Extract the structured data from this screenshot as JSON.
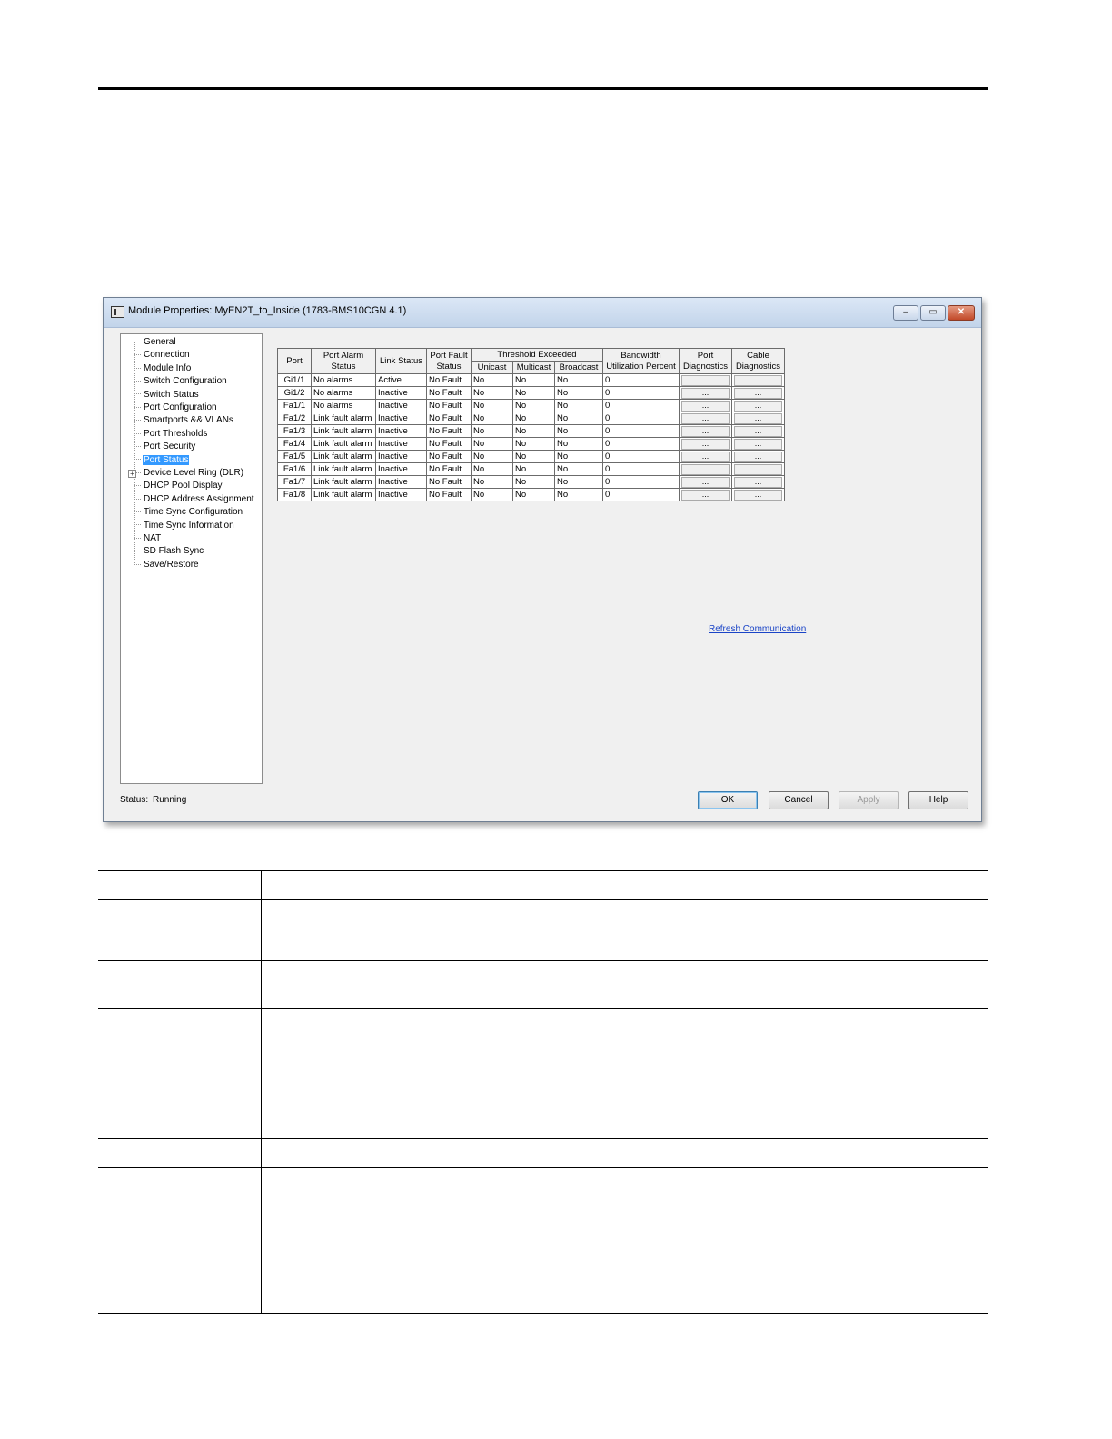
{
  "dialog": {
    "title": "Module Properties: MyEN2T_to_Inside (1783-BMS10CGN 4.1)",
    "window_buttons": {
      "minimize": "–",
      "restore": "▭",
      "close": "✕"
    }
  },
  "tree": {
    "items": [
      {
        "label": "General"
      },
      {
        "label": "Connection"
      },
      {
        "label": "Module Info"
      },
      {
        "label": "Switch Configuration"
      },
      {
        "label": "Switch Status"
      },
      {
        "label": "Port Configuration"
      },
      {
        "label": "Smartports && VLANs"
      },
      {
        "label": "Port Thresholds"
      },
      {
        "label": "Port Security"
      },
      {
        "label": "Port Status",
        "selected": true
      },
      {
        "label": "Device Level Ring (DLR)",
        "expandable": true
      },
      {
        "label": "DHCP Pool Display"
      },
      {
        "label": "DHCP Address Assignment"
      },
      {
        "label": "Time Sync Configuration"
      },
      {
        "label": "Time Sync Information"
      },
      {
        "label": "NAT"
      },
      {
        "label": "SD Flash Sync"
      },
      {
        "label": "Save/Restore"
      }
    ]
  },
  "grid": {
    "headers": {
      "port": "Port",
      "alarm": "Port Alarm Status",
      "link": "Link Status",
      "fault": "Port Fault Status",
      "threshold": "Threshold Exceeded",
      "unicast": "Unicast",
      "multicast": "Multicast",
      "broadcast": "Broadcast",
      "bandwidth": "Bandwidth Utilization Percent",
      "port_diag": "Port Diagnostics",
      "cable_diag": "Cable Diagnostics"
    },
    "rows": [
      {
        "port": "Gi1/1",
        "alarm": "No alarms",
        "link": "Active",
        "fault": "No Fault",
        "unicast": "No",
        "multicast": "No",
        "broadcast": "No",
        "bandwidth": "0",
        "port_diag": "...",
        "cable_diag": "..."
      },
      {
        "port": "Gi1/2",
        "alarm": "No alarms",
        "link": "Inactive",
        "fault": "No Fault",
        "unicast": "No",
        "multicast": "No",
        "broadcast": "No",
        "bandwidth": "0",
        "port_diag": "...",
        "cable_diag": "..."
      },
      {
        "port": "Fa1/1",
        "alarm": "No alarms",
        "link": "Inactive",
        "fault": "No Fault",
        "unicast": "No",
        "multicast": "No",
        "broadcast": "No",
        "bandwidth": "0",
        "port_diag": "...",
        "cable_diag": "..."
      },
      {
        "port": "Fa1/2",
        "alarm": "Link fault alarm",
        "link": "Inactive",
        "fault": "No Fault",
        "unicast": "No",
        "multicast": "No",
        "broadcast": "No",
        "bandwidth": "0",
        "port_diag": "...",
        "cable_diag": "..."
      },
      {
        "port": "Fa1/3",
        "alarm": "Link fault alarm",
        "link": "Inactive",
        "fault": "No Fault",
        "unicast": "No",
        "multicast": "No",
        "broadcast": "No",
        "bandwidth": "0",
        "port_diag": "...",
        "cable_diag": "..."
      },
      {
        "port": "Fa1/4",
        "alarm": "Link fault alarm",
        "link": "Inactive",
        "fault": "No Fault",
        "unicast": "No",
        "multicast": "No",
        "broadcast": "No",
        "bandwidth": "0",
        "port_diag": "...",
        "cable_diag": "..."
      },
      {
        "port": "Fa1/5",
        "alarm": "Link fault alarm",
        "link": "Inactive",
        "fault": "No Fault",
        "unicast": "No",
        "multicast": "No",
        "broadcast": "No",
        "bandwidth": "0",
        "port_diag": "...",
        "cable_diag": "..."
      },
      {
        "port": "Fa1/6",
        "alarm": "Link fault alarm",
        "link": "Inactive",
        "fault": "No Fault",
        "unicast": "No",
        "multicast": "No",
        "broadcast": "No",
        "bandwidth": "0",
        "port_diag": "...",
        "cable_diag": "..."
      },
      {
        "port": "Fa1/7",
        "alarm": "Link fault alarm",
        "link": "Inactive",
        "fault": "No Fault",
        "unicast": "No",
        "multicast": "No",
        "broadcast": "No",
        "bandwidth": "0",
        "port_diag": "...",
        "cable_diag": "..."
      },
      {
        "port": "Fa1/8",
        "alarm": "Link fault alarm",
        "link": "Inactive",
        "fault": "No Fault",
        "unicast": "No",
        "multicast": "No",
        "broadcast": "No",
        "bandwidth": "0",
        "port_diag": "...",
        "cable_diag": "..."
      }
    ]
  },
  "refresh_link": "Refresh Communication",
  "status": {
    "label": "Status:",
    "value": "Running"
  },
  "buttons": {
    "ok": "OK",
    "cancel": "Cancel",
    "apply": "Apply",
    "help": "Help"
  }
}
